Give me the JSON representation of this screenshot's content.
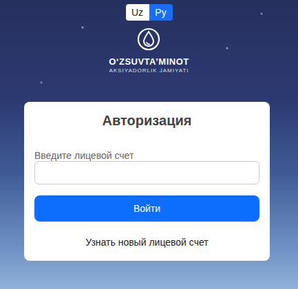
{
  "language_switch": [
    {
      "label": "Uz",
      "selected": false
    },
    {
      "label": "Ру",
      "selected": true
    }
  ],
  "logo": {
    "title": "O‘ZSUVTA’MINOT",
    "subtitle": "AKSIYADORLIK JAMIYATI"
  },
  "form": {
    "title": "Авторизация",
    "field_label": "Введите лицевой счет",
    "field_value": "",
    "submit": "Войти",
    "link": "Узнать новый лицевой счет"
  }
}
